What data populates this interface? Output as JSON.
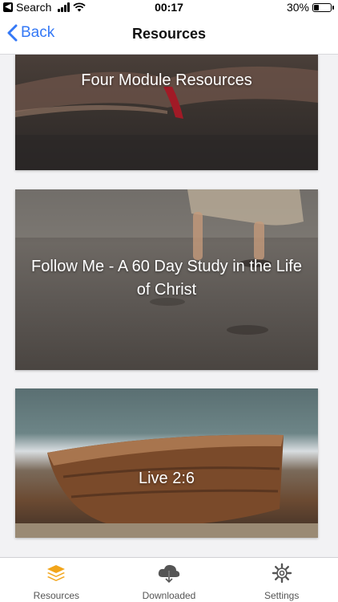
{
  "status": {
    "carrier": "Search",
    "time": "00:17",
    "battery": "30%",
    "battery_level": 0.3
  },
  "nav": {
    "back_label": "Back",
    "title": "Resources"
  },
  "resources": [
    {
      "title": "Four Module Resources"
    },
    {
      "title": "Follow Me - A 60 Day Study in the Life of Christ"
    },
    {
      "title": "Live 2:6"
    }
  ],
  "tabs": [
    {
      "label": "Resources",
      "icon": "stack-layers-icon",
      "active": true,
      "color": "#f2a51a"
    },
    {
      "label": "Downloaded",
      "icon": "cloud-download-icon",
      "active": false
    },
    {
      "label": "Settings",
      "icon": "gear-icon",
      "active": false
    }
  ]
}
